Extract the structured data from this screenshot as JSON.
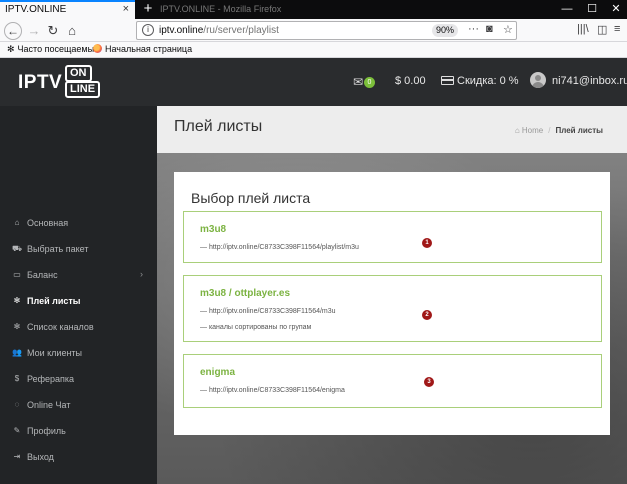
{
  "browser": {
    "tab_title": "IPTV.ONLINE",
    "tab2_title": "IPTV.ONLINE - Mozilla Firefox",
    "url_host": "iptv.online",
    "url_path": "/ru/server/playlist",
    "zoom": "90%",
    "bookmarks": [
      "Часто посещаемые",
      "Начальная страница"
    ]
  },
  "site": {
    "logo_main": "IPTV",
    "logo_on": "ON",
    "logo_line": "LINE",
    "messages_count": "0",
    "balance": "$ 0.00",
    "discount": "Скидка: 0 %",
    "user_email": "ni741@inbox.ru"
  },
  "sidebar": {
    "items": [
      {
        "icon": "home-icon",
        "label": "Основная"
      },
      {
        "icon": "cart-icon",
        "label": "Выбрать пакет"
      },
      {
        "icon": "card-icon",
        "label": "Баланс"
      },
      {
        "icon": "gear-icon",
        "label": "Плей листы"
      },
      {
        "icon": "gear-icon",
        "label": "Список каналов"
      },
      {
        "icon": "users-icon",
        "label": "Мои клиенты"
      },
      {
        "icon": "dollar-icon",
        "label": "Реферапка"
      },
      {
        "icon": "chat-icon",
        "label": "Online Чат"
      },
      {
        "icon": "edit-icon",
        "label": "Профиль"
      },
      {
        "icon": "logout-icon",
        "label": "Выход"
      }
    ]
  },
  "page": {
    "title": "Плей листы",
    "breadcrumb_home": "Home",
    "breadcrumb_current": "Плей листы",
    "panel_title": "Выбор плей листа"
  },
  "playlists": [
    {
      "name": "m3u8",
      "lines": [
        "— http://iptv.online/C8733C398F11564/playlist/m3u"
      ],
      "badge": "1"
    },
    {
      "name": "m3u8 / ottplayer.es",
      "lines": [
        "— http://iptv.online/C8733C398F11564/m3u",
        "— каналы сортированы по групам"
      ],
      "badge": "2"
    },
    {
      "name": "enigma",
      "lines": [
        "— http://iptv.online/C8733C398F11564/enigma"
      ],
      "badge": "3"
    }
  ]
}
